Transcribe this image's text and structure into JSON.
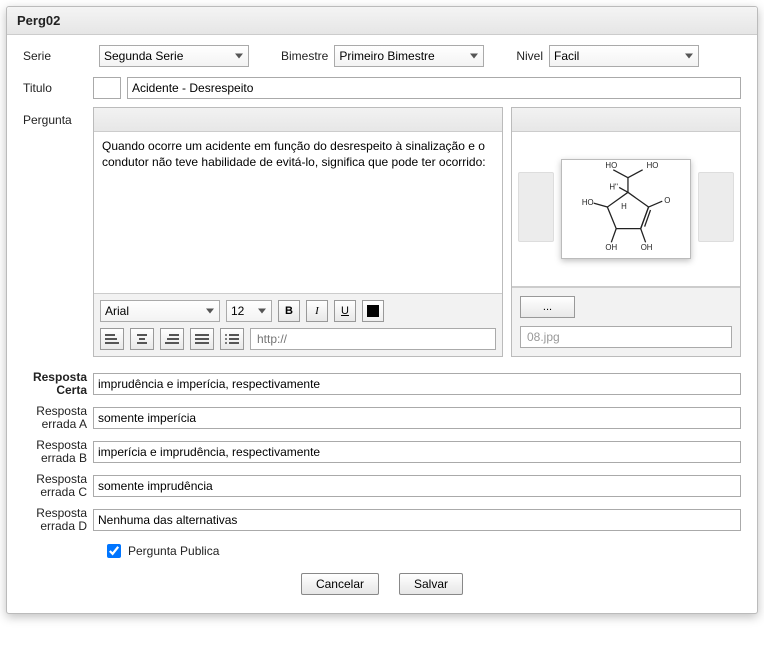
{
  "window": {
    "title": "Perg02"
  },
  "labels": {
    "serie": "Serie",
    "bimestre": "Bimestre",
    "nivel": "Nivel",
    "titulo": "Titulo",
    "pergunta": "Pergunta",
    "resposta_certa_l1": "Resposta",
    "resposta_certa_l2": "Certa",
    "resp_a_l1": "Resposta",
    "resp_a_l2": "errada A",
    "resp_b_l1": "Resposta",
    "resp_b_l2": "errada B",
    "resp_c_l1": "Resposta",
    "resp_c_l2": "errada C",
    "resp_d_l1": "Resposta",
    "resp_d_l2": "errada D",
    "publica": "Pergunta Publica"
  },
  "selects": {
    "serie": "Segunda Serie",
    "bimestre": "Primeiro Bimestre",
    "nivel": "Facil"
  },
  "fields": {
    "titulo": "Acidente - Desrespeito",
    "pergunta": "Quando ocorre um acidente em função do desrespeito à sinalização e o condutor não teve habilidade de evitá-lo, significa que pode ter ocorrido:",
    "resposta_certa": "imprudência e imperícia, respectivamente",
    "resposta_a": "somente imperícia",
    "resposta_b": "imperícia e imprudência, respectivamente",
    "resposta_c": "somente imprudência",
    "resposta_d": "Nenhuma das alternativas",
    "url_placeholder": "http://",
    "image_file": "08.jpg"
  },
  "editor": {
    "font": "Arial",
    "size": "12",
    "bold": "B",
    "italic": "I",
    "underline": "U",
    "browse": "..."
  },
  "buttons": {
    "cancel": "Cancelar",
    "save": "Salvar"
  },
  "checkbox": {
    "publica_checked": true
  }
}
